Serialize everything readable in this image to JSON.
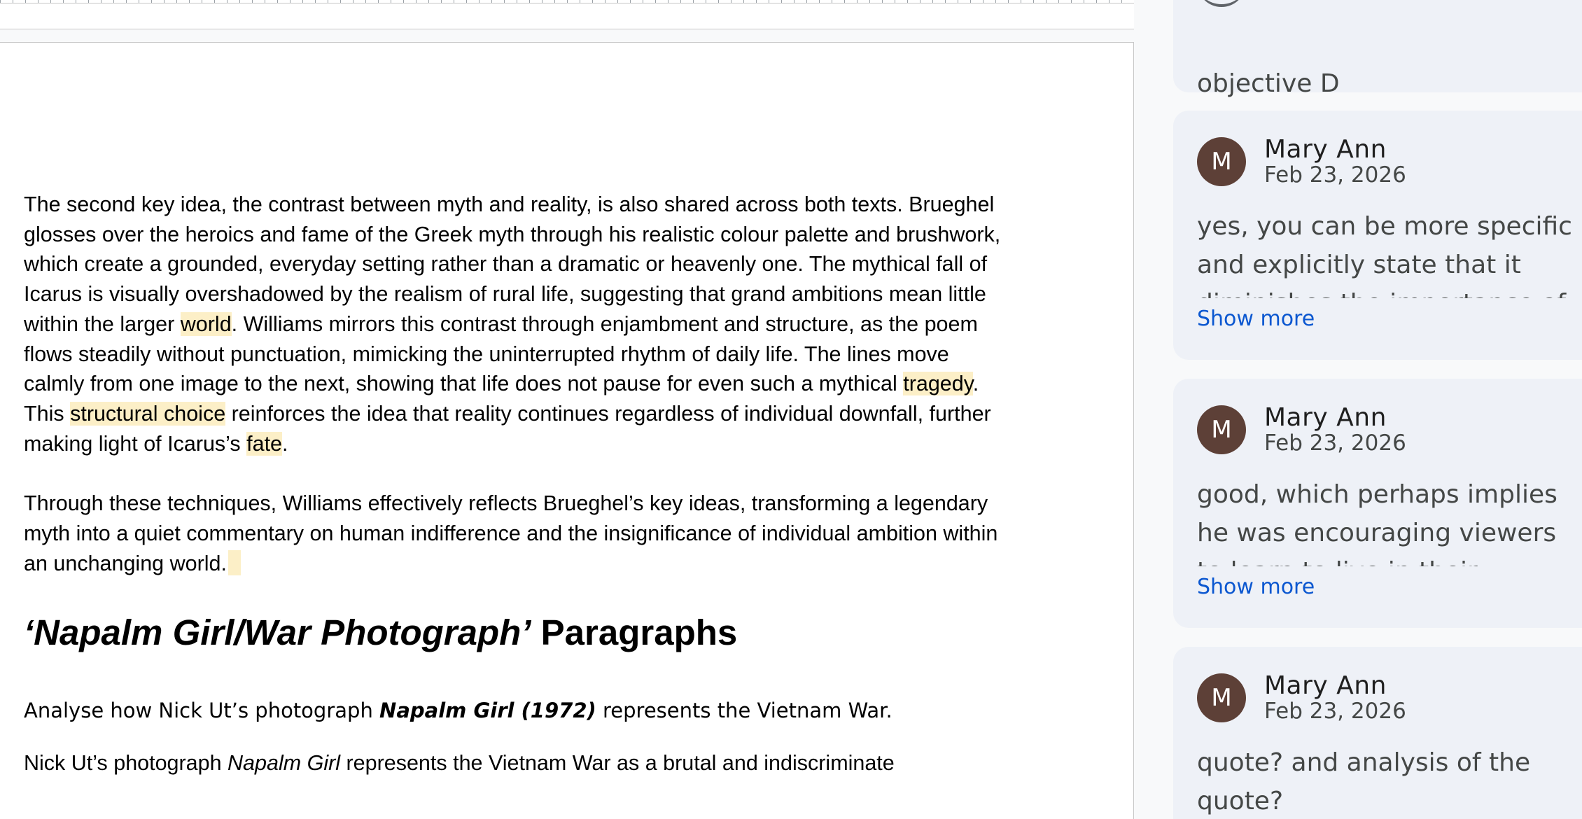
{
  "document": {
    "para1": {
      "t1": "The second key idea, the contrast between myth and reality, is also shared across both texts. Brueghel glosses over the heroics and fame of the Greek myth through his realistic colour palette and brushwork, which create a grounded, everyday setting rather than a dramatic or heavenly one. The mythical fall of Icarus is visually overshadowed by the realism of rural life, suggesting that grand ambitions mean little within the larger ",
      "h1": "world",
      "t2": ". Williams mirrors this contrast through enjambment and structure, as the poem flows steadily without punctuation, mimicking the uninterrupted rhythm of daily life. The lines move calmly from one image to the next, showing that life does not pause for even such a mythical ",
      "h2": "tragedy",
      "t3": ". This ",
      "h3": "structural choice",
      "t4": " reinforces the idea that reality continues regardless of individual downfall, further making light of Icarus’s ",
      "h4": "fate",
      "t5": "."
    },
    "para2": "Through these techniques, Williams effectively reflects Brueghel’s key ideas, transforming a legendary myth into a quiet commentary on human indifference and the insignificance of individual ambition within an unchanging world.",
    "heading": {
      "italic": "‘Napalm Girl/War Photograph’",
      "rest": " Paragraphs"
    },
    "question": {
      "pre": "Analyse how Nick Ut’s photograph ",
      "bold": "Napalm Girl (1972)",
      "post": " represents the Vietnam War."
    },
    "next_line": {
      "pre": "Nick Ut’s photograph ",
      "italic": "Napalm Girl",
      "post": " represents the Vietnam War as a brutal and indiscriminate"
    }
  },
  "comments": [
    {
      "body": "objective D"
    },
    {
      "avatar_letter": "M",
      "author": "Mary Ann",
      "date": "Feb 23, 2026",
      "body": "yes, you can be more specific and explicitly state that it diminishes the importance of",
      "show_more": "Show more"
    },
    {
      "avatar_letter": "M",
      "author": "Mary Ann",
      "date": "Feb 23, 2026",
      "body": "good, which perhaps implies he was encouraging viewers to learn to live in their",
      "show_more": "Show more"
    },
    {
      "avatar_letter": "M",
      "author": "Mary Ann",
      "date": "Feb 23, 2026",
      "body": "quote? and analysis of the quote?"
    }
  ],
  "colors": {
    "highlight": "#fcefc7",
    "avatar": "#5d4037",
    "link": "#0b57d0",
    "card": "#eef1f7"
  }
}
